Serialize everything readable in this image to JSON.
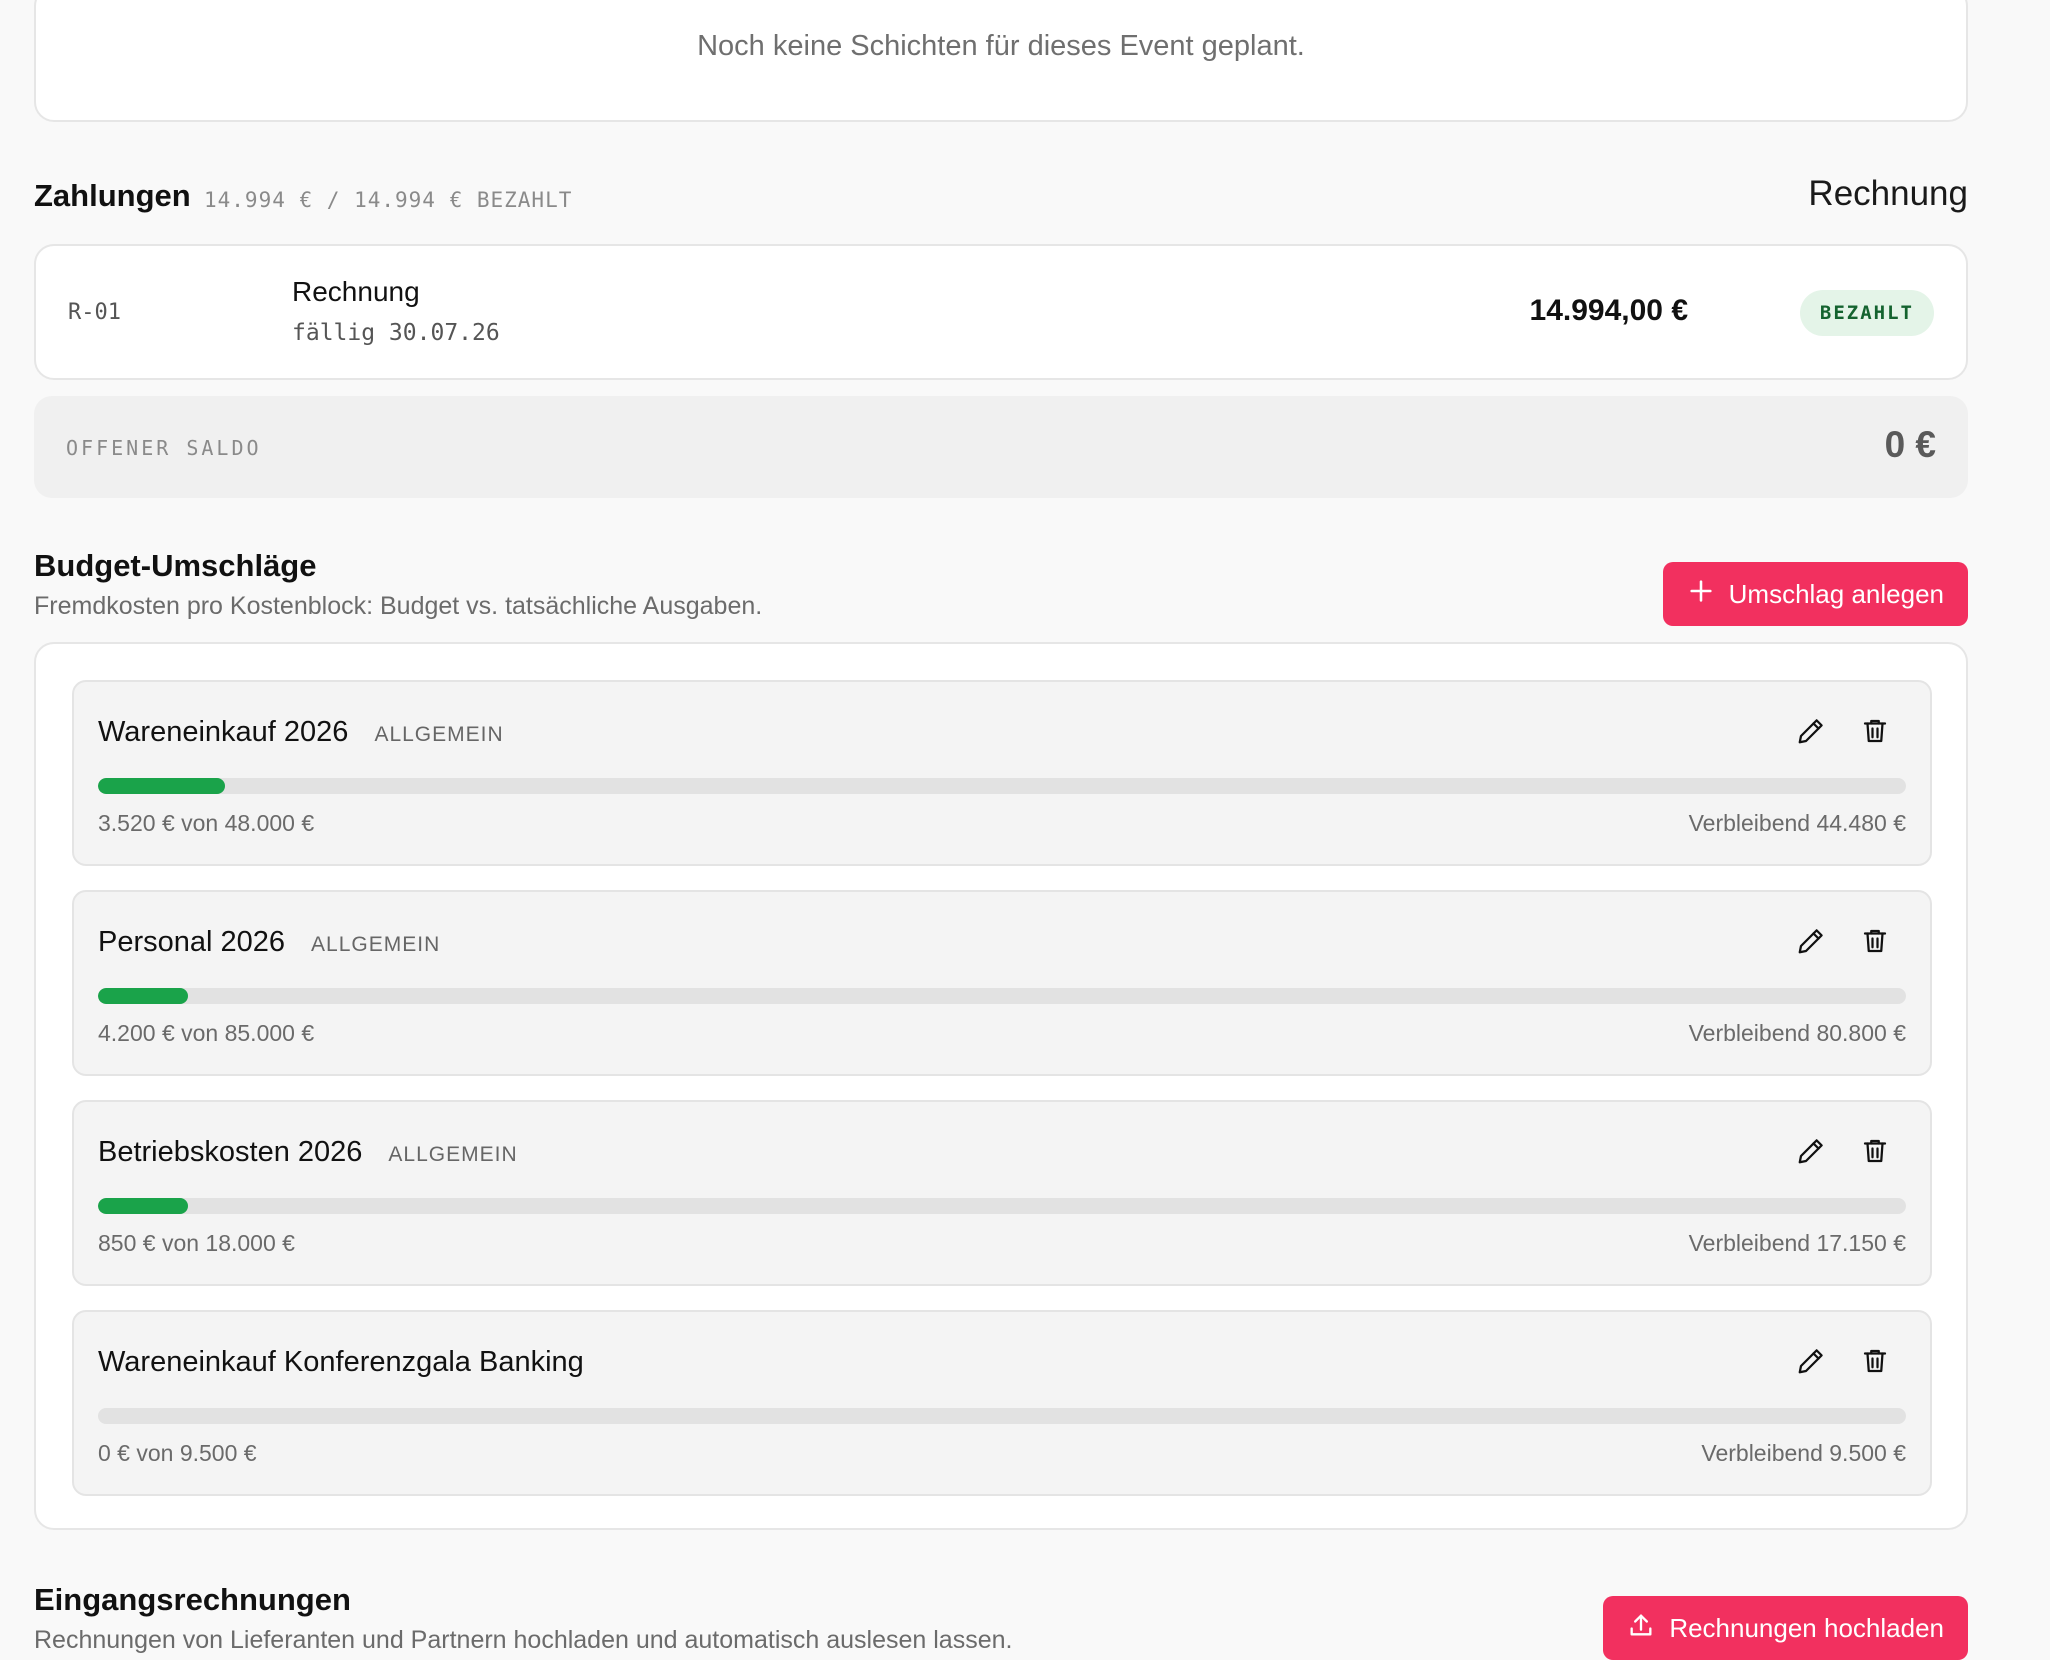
{
  "shifts": {
    "empty_message": "Noch keine Schichten für dieses Event geplant."
  },
  "payments": {
    "title": "Zahlungen",
    "summary": "14.994 € / 14.994 € BEZAHLT",
    "invoice_link": "Rechnung",
    "items": [
      {
        "id": "R-01",
        "name": "Rechnung",
        "due": "fällig 30.07.26",
        "amount": "14.994,00 €",
        "status": "BEZAHLT"
      }
    ],
    "open_balance_label": "OFFENER SALDO",
    "open_balance_value": "0 €"
  },
  "budget": {
    "title": "Budget-Umschläge",
    "subtitle": "Fremdkosten pro Kostenblock: Budget vs. tatsächliche Ausgaben.",
    "add_button": "Umschlag anlegen",
    "envelopes": [
      {
        "name": "Wareneinkauf 2026",
        "tag": "ALLGEMEIN",
        "spent": "3.520 € von 48.000 €",
        "remaining": "Verbleibend 44.480 €",
        "progress": 0.07
      },
      {
        "name": "Personal 2026",
        "tag": "ALLGEMEIN",
        "spent": "4.200 € von 85.000 €",
        "remaining": "Verbleibend 80.800 €",
        "progress": 0.05
      },
      {
        "name": "Betriebskosten 2026",
        "tag": "ALLGEMEIN",
        "spent": "850 € von 18.000 €",
        "remaining": "Verbleibend 17.150 €",
        "progress": 0.05
      },
      {
        "name": "Wareneinkauf Konferenzgala Banking",
        "tag": "",
        "spent": "0 € von 9.500 €",
        "remaining": "Verbleibend 9.500 €",
        "progress": 0
      }
    ]
  },
  "incoming": {
    "title": "Eingangsrechnungen",
    "subtitle": "Rechnungen von Lieferanten und Partnern hochladen und automatisch auslesen lassen.",
    "upload_button": "Rechnungen hochladen"
  },
  "colors": {
    "accent": "#f2305f",
    "progress": "#1aa34a",
    "paid_badge_bg": "#e4f4e8",
    "paid_badge_text": "#14632f"
  },
  "icons": {
    "add": "plus-icon",
    "edit": "pencil-icon",
    "delete": "trash-icon",
    "upload": "upload-icon"
  }
}
